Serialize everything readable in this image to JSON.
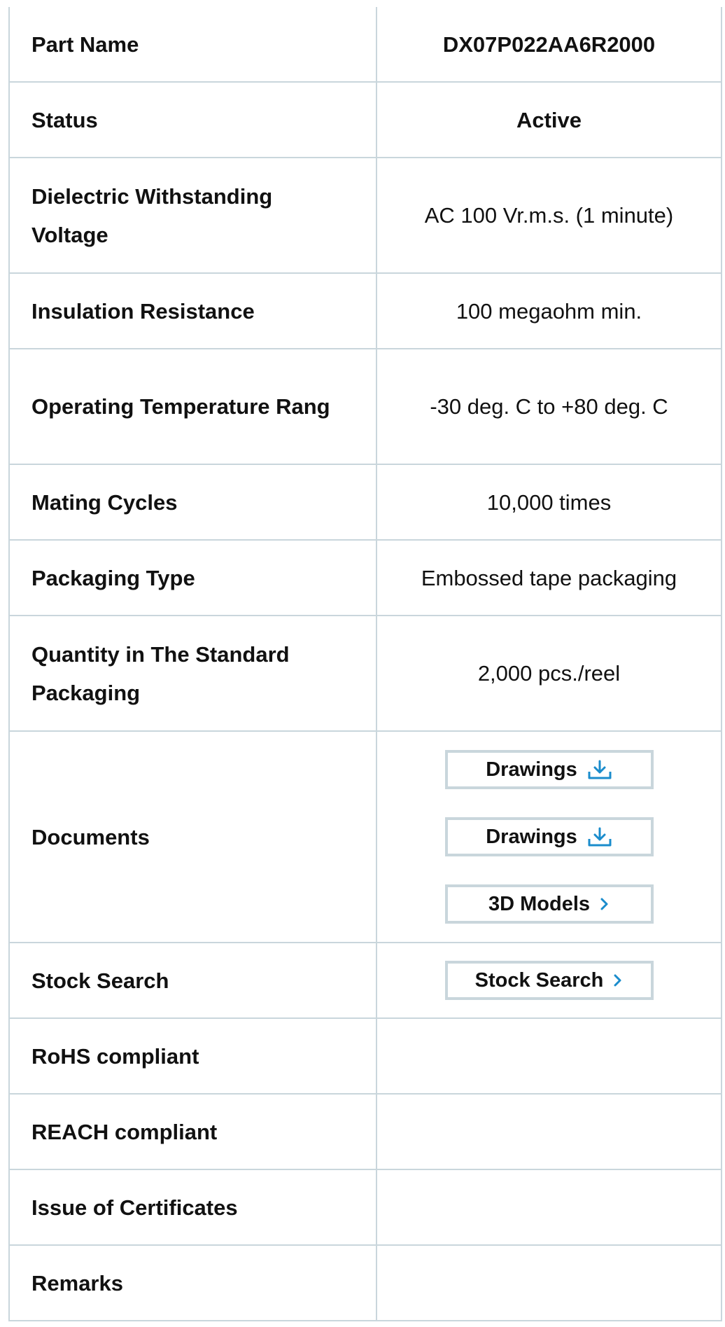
{
  "colors": {
    "border": "#c9d6dc",
    "accent": "#1a8ccc",
    "text": "#111111"
  },
  "rows": {
    "part_name": {
      "label": "Part Name",
      "value": "DX07P022AA6R2000"
    },
    "status": {
      "label": "Status",
      "value": "Active"
    },
    "dielectric": {
      "label": "Dielectric Withstanding Voltage",
      "value": "AC 100 Vr.m.s. (1 minute)"
    },
    "insulation": {
      "label": "Insulation Resistance",
      "value": "100 megaohm min."
    },
    "operating_temp": {
      "label": "Operating Temperature Rang",
      "value": "-30 deg. C to +80 deg. C"
    },
    "mating_cycles": {
      "label": "Mating Cycles",
      "value": "10,000 times"
    },
    "packaging_type": {
      "label": "Packaging Type",
      "value": "Embossed tape packaging"
    },
    "quantity": {
      "label": "Quantity in The Standard Packaging",
      "value": "2,000 pcs./reel"
    },
    "documents": {
      "label": "Documents",
      "buttons": [
        {
          "label": "Drawings",
          "icon": "download-icon"
        },
        {
          "label": "Drawings",
          "icon": "download-icon"
        },
        {
          "label": "3D Models",
          "icon": "chevron-right-icon"
        }
      ]
    },
    "stock_search": {
      "label": "Stock Search",
      "button": {
        "label": "Stock Search",
        "icon": "chevron-right-icon"
      }
    },
    "rohs": {
      "label": "RoHS compliant",
      "value": ""
    },
    "reach": {
      "label": "REACH compliant",
      "value": ""
    },
    "certificates": {
      "label": "Issue of Certificates",
      "value": ""
    },
    "remarks": {
      "label": "Remarks",
      "value": ""
    }
  }
}
